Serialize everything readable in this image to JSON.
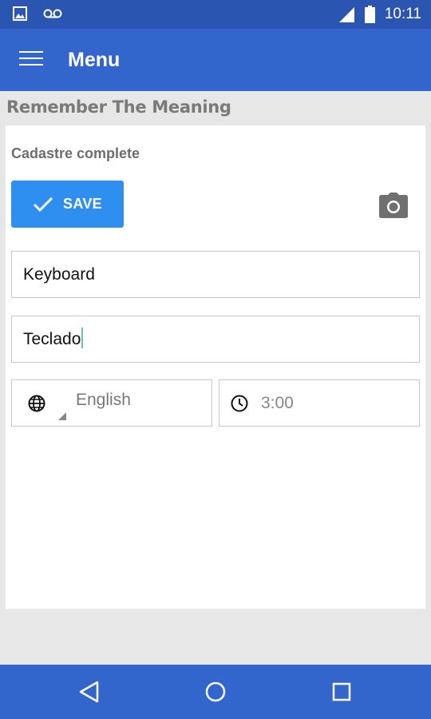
{
  "status_bar": {
    "time": "10:11",
    "icons": [
      "image-icon",
      "voicemail-icon",
      "signal-icon",
      "battery-icon"
    ]
  },
  "app_bar": {
    "title": "Menu"
  },
  "section": {
    "title": "Remember The Meaning"
  },
  "form": {
    "subtitle": "Cadastre complete",
    "save_label": "SAVE",
    "word_value": "Keyboard",
    "translation_value": "Teclado",
    "language_value": "English",
    "time_value": "3:00"
  },
  "colors": {
    "status_bar": "#2a55b0",
    "app_bar": "#3366cc",
    "save_button": "#2f8ff0",
    "background": "#e7e7e7"
  }
}
